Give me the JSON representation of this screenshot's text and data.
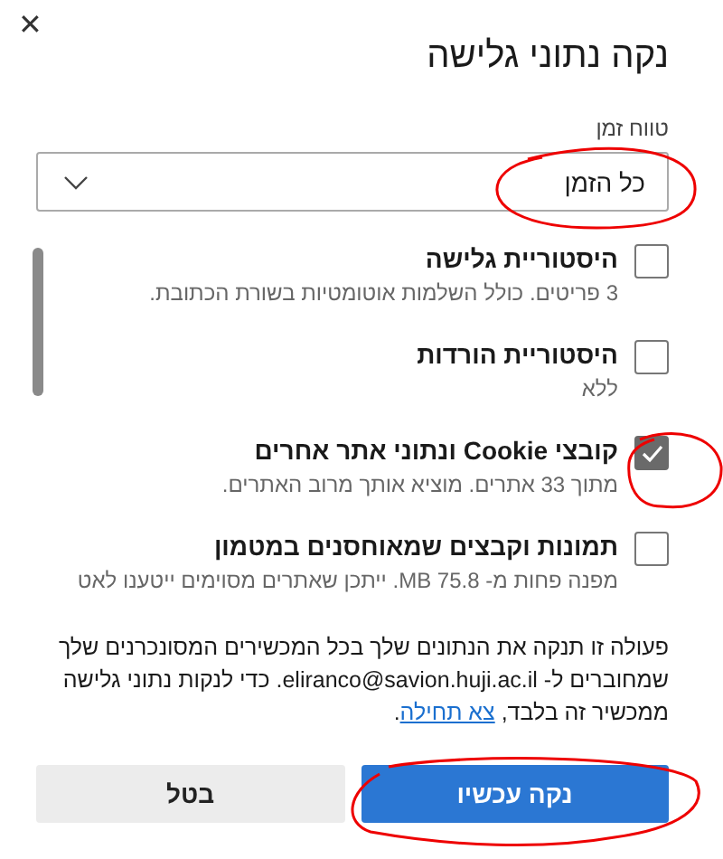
{
  "dialog": {
    "close": "✕",
    "title": "נקה נתוני גלישה"
  },
  "time_range": {
    "label": "טווח זמן",
    "value": "כל הזמן"
  },
  "items": [
    {
      "label": "היסטוריית גלישה",
      "detail": "3 פריטים. כולל השלמות אוטומטיות בשורת הכתובת.",
      "checked": false
    },
    {
      "label": "היסטוריית הורדות",
      "detail": "ללא",
      "checked": false
    },
    {
      "label": "קובצי Cookie ונתוני אתר אחרים",
      "detail": "מתוך 33 אתרים. מוציא אותך מרוב האתרים.",
      "checked": true
    },
    {
      "label": "תמונות וקבצים שמאוחסנים במטמון",
      "detail": "מפנה פחות מ- 75.8 MB. ייתכן שאתרים מסוימים ייטענו לאט",
      "checked": false
    }
  ],
  "note": {
    "text": "פעולה זו תנקה את הנתונים שלך בכל המכשירים המסונכרנים שלך שמחוברים ל- eliranco@savion.huji.ac.il. כדי לנקות נתוני גלישה ממכשיר זה בלבד, ",
    "link": "צא תחילה",
    "end": "."
  },
  "buttons": [
    {
      "label": "נקה עכשיו",
      "kind": "primary"
    },
    {
      "label": "בטל",
      "kind": "secondary"
    }
  ]
}
